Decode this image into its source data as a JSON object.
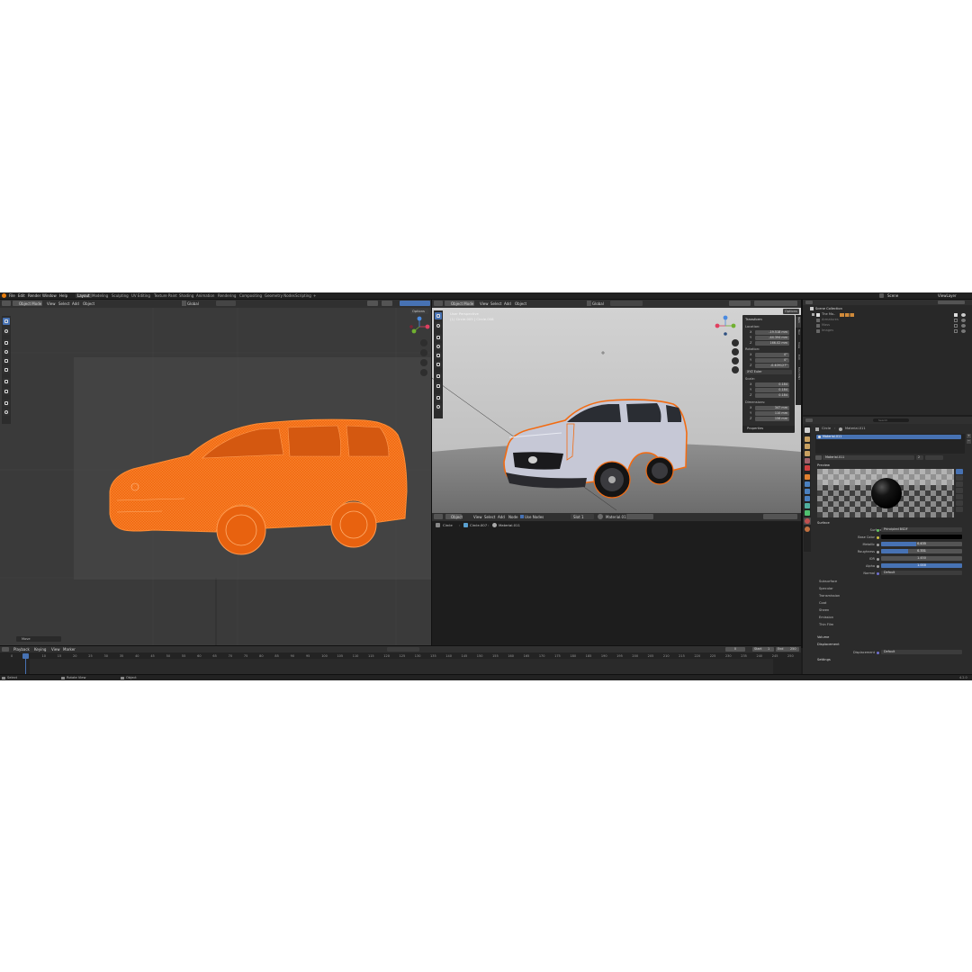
{
  "menu": [
    "File",
    "Edit",
    "Render",
    "Window",
    "Help"
  ],
  "workspaces": [
    "Layout",
    "Modeling",
    "Sculpting",
    "UV Editing",
    "Texture Paint",
    "Shading",
    "Animation",
    "Rendering",
    "Compositing",
    "Geometry Nodes",
    "Scripting",
    "+"
  ],
  "active_workspace": "Layout",
  "scene_name": "Scene",
  "view_layer": "ViewLayer",
  "left_viewport": {
    "mode": "Object Mode",
    "menus": [
      "View",
      "Select",
      "Add",
      "Object"
    ],
    "orientation": "Global",
    "options": "Options",
    "status_label": "Move"
  },
  "right_viewport": {
    "mode": "Object Mode",
    "menus": [
      "View",
      "Select",
      "Add",
      "Object"
    ],
    "orientation": "Global",
    "options": "Options",
    "overlay_line1": "User Perspective",
    "overlay_line2": "(1) Circle.005 | Circle.008"
  },
  "n_panel": {
    "title": "Transform",
    "location_label": "Location:",
    "location": [
      {
        "axis": "X",
        "value": "-19.518 mm"
      },
      {
        "axis": "Y",
        "value": "-44.394 mm"
      },
      {
        "axis": "Z",
        "value": "166.02 mm"
      }
    ],
    "rotation_label": "Rotation:",
    "rotation": [
      {
        "axis": "X",
        "value": "0°"
      },
      {
        "axis": "Y",
        "value": "0°"
      },
      {
        "axis": "Z",
        "value": "-0.409127°"
      }
    ],
    "rotation_mode": "XYZ Euler",
    "scale_label": "Scale:",
    "scale": [
      {
        "axis": "X",
        "value": "0.184"
      },
      {
        "axis": "Y",
        "value": "0.184"
      },
      {
        "axis": "Z",
        "value": "0.184"
      }
    ],
    "dimensions_label": "Dimensions:",
    "dimensions": [
      {
        "axis": "X",
        "value": "347 mm"
      },
      {
        "axis": "Y",
        "value": "110 mm"
      },
      {
        "axis": "Z",
        "value": "156 mm"
      }
    ],
    "properties_label": "Properties",
    "tabs": [
      "Item",
      "Tool",
      "View",
      "Edit",
      "MACHIN3"
    ]
  },
  "shader_editor": {
    "object_type": "Object",
    "menus": [
      "View",
      "Select",
      "Add",
      "Node"
    ],
    "use_nodes": "Use Nodes",
    "slot": "Slot 1",
    "material": "Material.011",
    "breadcrumb": [
      "Circle",
      "Circle.007",
      "Material.011"
    ]
  },
  "outliner": {
    "header_label": "Scene Collection",
    "items": [
      {
        "name": "The Mo..",
        "color": "#cfcfcf"
      },
      {
        "name": "Armatures",
        "color": "#7d7d7d"
      },
      {
        "name": "Mass",
        "color": "#7d7d7d"
      },
      {
        "name": "Images",
        "color": "#7d7d7d"
      }
    ]
  },
  "properties": {
    "search_placeholder": "Search",
    "breadcrumb": [
      "Circle",
      "Material.011"
    ],
    "material_slot": "Material.011",
    "material_name": "Material.011",
    "user_count": "2",
    "preview_label": "Preview",
    "surface_section": "Surface",
    "fields": [
      {
        "label": "Surface",
        "value": "Principled BSDF",
        "type": "text"
      },
      {
        "label": "Base Color",
        "value": "",
        "type": "color"
      },
      {
        "label": "Metallic",
        "value": "0.435",
        "type": "slider",
        "fraction": 0.435
      },
      {
        "label": "Roughness",
        "value": "0.331",
        "type": "slider",
        "fraction": 0.331
      },
      {
        "label": "IOR",
        "value": "1.450",
        "type": "text"
      },
      {
        "label": "Alpha",
        "value": "1.000",
        "type": "slider",
        "fraction": 1.0
      },
      {
        "label": "Normal",
        "value": "Default",
        "type": "text"
      }
    ],
    "subpanels": [
      "Subsurface",
      "Specular",
      "Transmission",
      "Coat",
      "Sheen",
      "Emission",
      "Thin Film"
    ],
    "volume_section": "Volume",
    "displacement_section": "Displacement",
    "displacement_label": "Displacement",
    "displacement_value": "Default",
    "settings_label": "Settings"
  },
  "timeline": {
    "menus": [
      "Playback",
      "Keying",
      "View",
      "Marker"
    ],
    "current_frame": "0",
    "start_label": "Start",
    "start": "1",
    "end_label": "End",
    "end": "250",
    "ticks": [
      "0",
      "5",
      "10",
      "15",
      "20",
      "25",
      "30",
      "35",
      "40",
      "45",
      "50",
      "55",
      "60",
      "65",
      "70",
      "75",
      "80",
      "85",
      "90",
      "95",
      "100",
      "105",
      "110",
      "115",
      "120",
      "125",
      "130",
      "135",
      "140",
      "145",
      "150",
      "155",
      "160",
      "165",
      "170",
      "175",
      "180",
      "185",
      "190",
      "195",
      "200",
      "205",
      "210",
      "215",
      "220",
      "225",
      "230",
      "235",
      "240",
      "245",
      "250"
    ]
  },
  "statusbar": {
    "left": "Select",
    "middle": "Rotate View",
    "right": "Object",
    "version": "4.2.0"
  },
  "colors": {
    "selection_orange": "#f26b12",
    "accent_blue": "#4772b3",
    "background": "#1d1d1d"
  }
}
